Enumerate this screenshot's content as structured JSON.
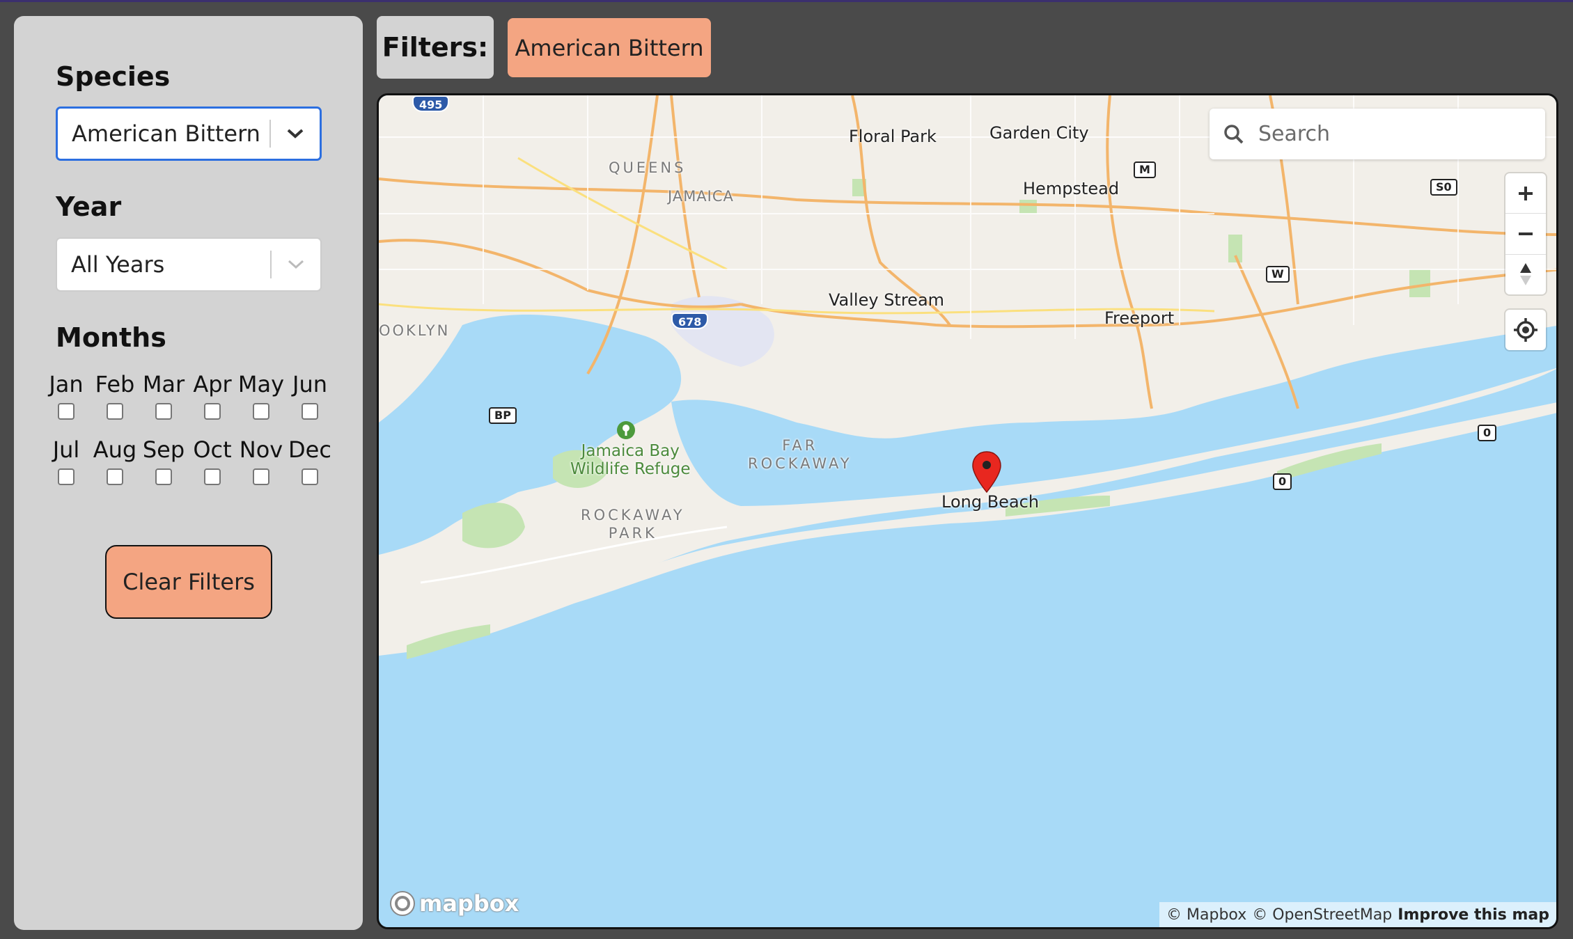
{
  "sidebar": {
    "species_title": "Species",
    "species_value": "American Bittern",
    "year_title": "Year",
    "year_value": "All Years",
    "months_title": "Months",
    "months_row1": [
      "Jan",
      "Feb",
      "Mar",
      "Apr",
      "May",
      "Jun"
    ],
    "months_row2": [
      "Jul",
      "Aug",
      "Sep",
      "Oct",
      "Nov",
      "Dec"
    ],
    "clear_label": "Clear Filters"
  },
  "filters": {
    "label": "Filters:",
    "active_chip": "American Bittern"
  },
  "map": {
    "search_placeholder": "Search",
    "places": {
      "floral_park": "Floral Park",
      "garden_city": "Garden City",
      "hempstead": "Hempstead",
      "queens": "QUEENS",
      "jamaica": "JAMAICA",
      "valley_stream": "Valley Stream",
      "freeport": "Freeport",
      "brooklyn": "OOKLYN",
      "jamaica_bay_1": "Jamaica Bay",
      "jamaica_bay_2": "Wildlife Refuge",
      "far_rockaway_1": "FAR",
      "far_rockaway_2": "ROCKAWAY",
      "rockaway_park_1": "ROCKAWAY",
      "rockaway_park_2": "PARK",
      "long_beach": "Long Beach"
    },
    "shields": {
      "i495": "495",
      "i678": "678",
      "m": "M",
      "s0": "S0",
      "w": "W",
      "bp": "BP",
      "r0a": "0",
      "r0b": "0"
    },
    "attribution_mapbox": "© Mapbox",
    "attribution_osm": "© OpenStreetMap",
    "attribution_improve": "Improve this map",
    "logo_text": "mapbox",
    "colors": {
      "water": "#a8daf7",
      "land": "#f2efe9",
      "park": "#c5e4b3",
      "road": "#f3b56b",
      "marker": "#e8271f"
    }
  }
}
